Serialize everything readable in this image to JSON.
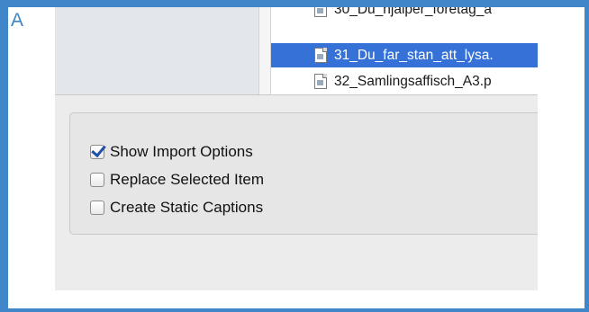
{
  "figure": {
    "letter": "A"
  },
  "file_list": {
    "items": [
      {
        "name": "30_Du_hjalper_foretag_a",
        "selected": false
      },
      {
        "name": "31_Du_far_stan_att_lysa.",
        "selected": true
      },
      {
        "name": "32_Samlingsaffisch_A3.p",
        "selected": false
      }
    ]
  },
  "options": {
    "show_import_options": {
      "label": "Show Import Options",
      "checked": true
    },
    "replace_selected_item": {
      "label": "Replace Selected Item",
      "checked": false
    },
    "create_static_captions": {
      "label": "Create Static Captions",
      "checked": false
    }
  },
  "colors": {
    "frame": "#3f87c8",
    "selection": "#3571d6",
    "checkmark": "#1f4fa6"
  },
  "icons": {
    "file": "document-icon"
  }
}
